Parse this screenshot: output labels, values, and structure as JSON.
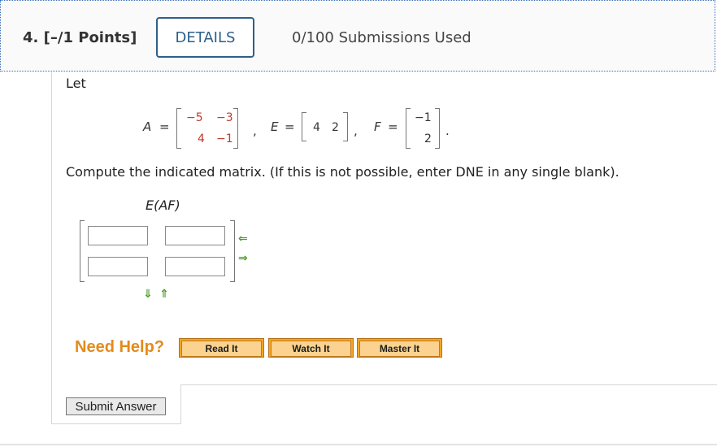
{
  "header": {
    "question_number": "4.",
    "points": "[–/1 Points]",
    "details_label": "DETAILS",
    "submissions": "0/100 Submissions Used"
  },
  "problem": {
    "intro": "Let",
    "matrix_A": {
      "name": "A",
      "eq": "=",
      "rows": [
        [
          "−5",
          "−3"
        ],
        [
          "4",
          "−1"
        ]
      ],
      "sep": ","
    },
    "matrix_E": {
      "name": "E",
      "eq": "=",
      "rows": [
        [
          "4",
          "2"
        ]
      ],
      "sep": ","
    },
    "matrix_F": {
      "name": "F",
      "eq": "=",
      "rows": [
        [
          "−1"
        ],
        [
          "2"
        ]
      ],
      "sep": "."
    },
    "prompt": "Compute the indicated matrix. (If this is not possible, enter DNE in any single blank).",
    "expression": "E(AF)"
  },
  "answer_inputs": [
    {
      "value": "",
      "placeholder": ""
    },
    {
      "value": "",
      "placeholder": ""
    },
    {
      "value": "",
      "placeholder": ""
    },
    {
      "value": "",
      "placeholder": ""
    }
  ],
  "controls": {
    "remove_column_icon": "arrow-left-icon",
    "add_column_icon": "arrow-right-icon",
    "add_row_icon": "arrow-down-icon",
    "remove_row_icon": "arrow-up-icon",
    "arrow_color": "#4a9a2a"
  },
  "help": {
    "label": "Need Help?",
    "buttons": [
      "Read It",
      "Watch It",
      "Master It"
    ],
    "label_color": "#e38b1c",
    "button_color": "#f5a623"
  },
  "submit_label": "Submit Answer"
}
